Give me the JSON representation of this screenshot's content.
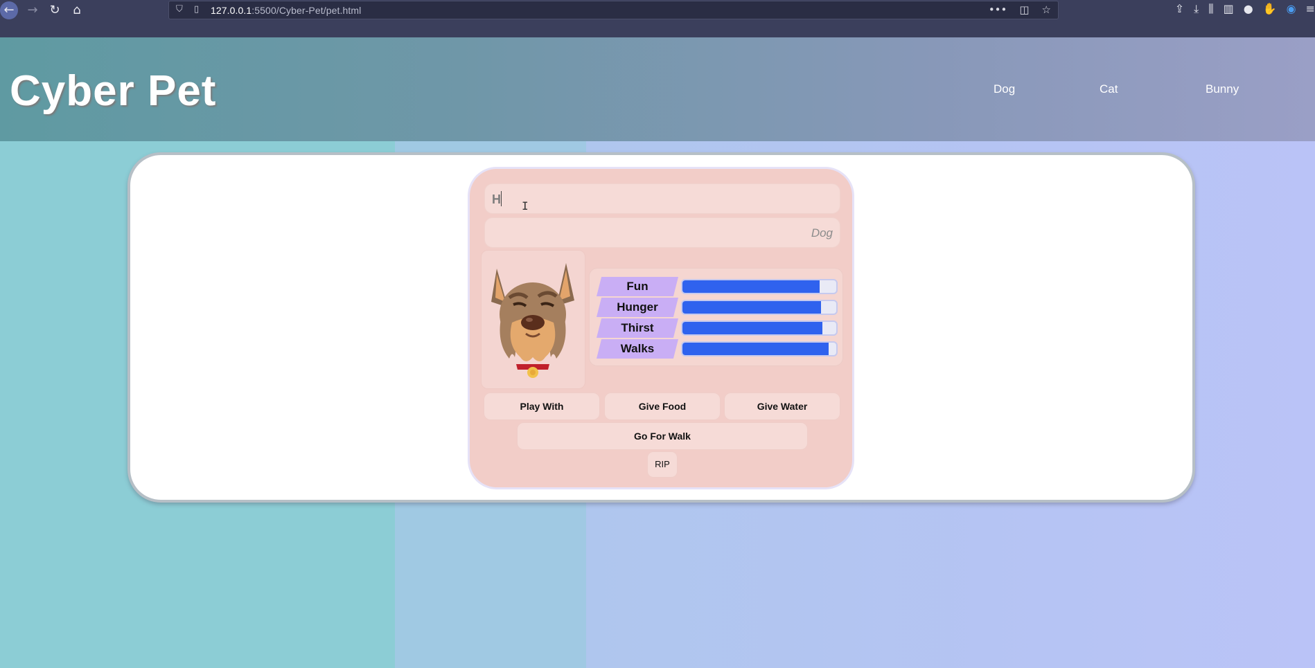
{
  "browser": {
    "url_host": "127.0.0.1",
    "url_path": ":5500/Cyber-Pet/pet.html",
    "back_icon": "arrow-left-icon",
    "forward_icon": "arrow-right-icon",
    "reload_icon": "reload-icon",
    "home_icon": "home-icon",
    "back_glyph": "←",
    "forward_glyph": "→",
    "reload_glyph": "↻",
    "home_glyph": "⌂",
    "shield_glyph": "⛉",
    "page_glyph": "▯",
    "more_glyph": "•••",
    "pocket_glyph": "◫",
    "star_glyph": "☆",
    "toolbar_glyphs": [
      "⇪",
      "⤓",
      "⫼",
      "▥",
      "●",
      "✋",
      "◉",
      "≡"
    ]
  },
  "header": {
    "title": "Cyber Pet",
    "nav": [
      "Dog",
      "Cat",
      "Bunny"
    ]
  },
  "pet": {
    "name_value": "H",
    "type_value": "Dog",
    "stats": [
      {
        "label": "Fun",
        "level": 0.89
      },
      {
        "label": "Hunger",
        "level": 0.9
      },
      {
        "label": "Thirst",
        "level": 0.91
      },
      {
        "label": "Walks",
        "level": 0.95
      }
    ],
    "actions": {
      "play": "Play With",
      "food": "Give Food",
      "water": "Give Water",
      "walk": "Go For Walk",
      "rip": "RIP"
    }
  },
  "colors": {
    "stat_fill": "#2f62ee",
    "stat_label_bg": "#c9aef5",
    "panel_bg": "#f2cdc8"
  }
}
